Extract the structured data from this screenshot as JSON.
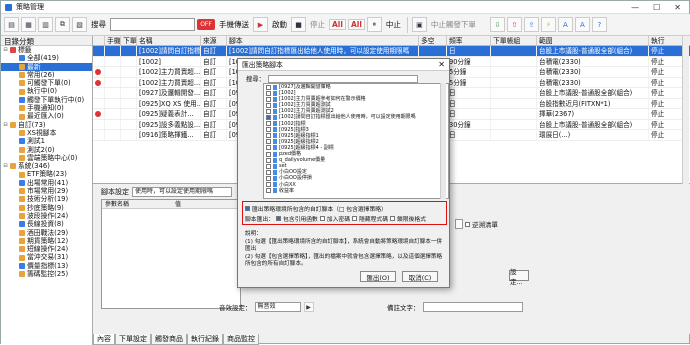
{
  "window": {
    "title": "策略管理"
  },
  "toolbar": {
    "search_label": "搜尋",
    "off_label": "OFF",
    "batch_label": "手機傳送",
    "start_label": "啟動",
    "stop_label": "停止",
    "all_on_label": "All",
    "all_off_label": "All",
    "pause_label": "中止",
    "order_label": "中止觸發下單"
  },
  "tree": {
    "header": "目錄分類",
    "nodes": [
      {
        "label": "標籤",
        "icon": "tag-icon",
        "level": 0
      },
      {
        "label": "全部(419)",
        "icon": "folder-icon",
        "level": 1
      },
      {
        "label": "最新",
        "icon": "folder-icon",
        "level": 1,
        "selected": true
      },
      {
        "label": "常用(26)",
        "icon": "folder-icon",
        "level": 1
      },
      {
        "label": "可觸發下單(0)",
        "icon": "folder-icon",
        "level": 1
      },
      {
        "label": "執行中(0)",
        "icon": "folder-icon",
        "level": 1
      },
      {
        "label": "觸發下單執行中(0)",
        "icon": "folder-icon",
        "level": 1
      },
      {
        "label": "手機通知(0)",
        "icon": "folder-icon",
        "level": 1
      },
      {
        "label": "最近匯入(0)",
        "icon": "folder-icon",
        "level": 1
      },
      {
        "label": "自訂(73)",
        "icon": "folder-icon",
        "level": 0
      },
      {
        "label": "XS視腳本",
        "icon": "folder-icon",
        "level": 1
      },
      {
        "label": "測試1",
        "icon": "folder-icon",
        "level": 1
      },
      {
        "label": "測試2(0)",
        "icon": "folder-icon",
        "level": 1
      },
      {
        "label": "雲端策略中心(0)",
        "icon": "folder-icon",
        "level": 1
      },
      {
        "label": "系統(346)",
        "icon": "folder-icon",
        "level": 0
      },
      {
        "label": "ETF策略(23)",
        "icon": "folder-icon",
        "level": 1
      },
      {
        "label": "出場常用(41)",
        "icon": "folder-icon",
        "level": 1
      },
      {
        "label": "市場常用(29)",
        "icon": "folder-icon",
        "level": 1
      },
      {
        "label": "技術分析(19)",
        "icon": "folder-icon",
        "level": 1
      },
      {
        "label": "抄底策略(9)",
        "icon": "folder-icon",
        "level": 1
      },
      {
        "label": "波段操作(24)",
        "icon": "folder-icon",
        "level": 1
      },
      {
        "label": "長線投資(8)",
        "icon": "folder-icon",
        "level": 1
      },
      {
        "label": "酒田戰法(29)",
        "icon": "folder-icon",
        "level": 1
      },
      {
        "label": "期貨策略(12)",
        "icon": "folder-icon",
        "level": 1
      },
      {
        "label": "短線操作(24)",
        "icon": "folder-icon",
        "level": 1
      },
      {
        "label": "當沖交易(31)",
        "icon": "folder-icon",
        "level": 1
      },
      {
        "label": "價量指標(13)",
        "icon": "folder-icon",
        "level": 1
      },
      {
        "label": "籌碼監控(25)",
        "icon": "folder-icon",
        "level": 1
      }
    ]
  },
  "grid": {
    "columns": [
      "",
      "手機",
      "下單",
      "名稱",
      "來源",
      "腳本",
      "多空",
      "頻率",
      "下單帳組",
      "範圍",
      "執行"
    ],
    "rows": [
      {
        "icon": false,
        "name": "[1002]請問自訂指標",
        "source": "自訂",
        "script": "[1002]請問自訂指標匯出給他人使用時，可以設定使用期限嗎",
        "side": "",
        "freq": "日",
        "range": "台股上市議股-普通股全部(組合)",
        "status": "停止",
        "hl": true
      },
      {
        "icon": false,
        "name": "[1002]",
        "source": "自訂",
        "script": "[1002]",
        "side": "",
        "freq": "90分鐘",
        "range": "台積電(2330)",
        "status": "停止"
      },
      {
        "icon": true,
        "name": "[1002]主力買賣超...",
        "source": "自訂",
        "script": "[1002]主力買賣超...",
        "side": "",
        "freq": "5分鐘",
        "range": "台積電(2330)",
        "status": "停止"
      },
      {
        "icon": true,
        "name": "[1002]主力買賣超...",
        "source": "自訂",
        "script": "[1002]主力買賣超...",
        "side": "",
        "freq": "5分鐘",
        "range": "台積電(2330)",
        "status": "停止"
      },
      {
        "icon": false,
        "name": "[0927]及邏輯開發...",
        "source": "自訂",
        "script": "[0927]及邏輯開發...",
        "side": "",
        "freq": "日",
        "range": "台股上市議股-普通股全部(組合)",
        "status": "停止"
      },
      {
        "icon": false,
        "name": "[0925]XQ XS 使用...",
        "source": "自訂",
        "script": "[0925]XQ XS 使用...",
        "side": "",
        "freq": "日",
        "range": "台股指數近月(FITXN*1)",
        "status": "停止"
      },
      {
        "icon": true,
        "name": "[0925]疑義表計...",
        "source": "自訂",
        "script": "[0925]疑義表計...",
        "side": "",
        "freq": "日",
        "range": "擇華(2367)",
        "status": "停止"
      },
      {
        "icon": false,
        "name": "[0925]設多義點設...",
        "source": "自訂",
        "script": "[0925]設多義點設...",
        "side": "",
        "freq": "30分鐘",
        "range": "台股上市議股-普通股全部(組合)",
        "status": "停止"
      },
      {
        "icon": false,
        "name": "[0916]策略揮鐵...",
        "source": "自訂",
        "script": "[0916]策略揮鐵...",
        "side": "",
        "freq": "日",
        "range": "環展日(...)",
        "status": "停止"
      }
    ]
  },
  "lower": {
    "script_label": "腳本設定",
    "script_value": "使用時，可以設定使用期限嗎",
    "params_label": "參數名稱",
    "value_label": "值",
    "fix_label": "逆溯清單",
    "settings_btn": "設定...",
    "sound_label": "音效設定：",
    "sound_value": "無音效",
    "extra_label": "備註文字："
  },
  "bottom_tabs": [
    "內容",
    "下單設定",
    "觸發商品",
    "執行紀錄",
    "商品監控"
  ],
  "modal": {
    "title": "匯出策略腳本",
    "search_label": "搜尋：",
    "items": [
      "[0927]及邏輯開發策略",
      "[1002]",
      "[1002]主力買賣超參考如何在警示價格",
      "[1002]主力買賣超測試",
      "[1002]主力買賣超測試2",
      "[1002]請問自訂指標匯出給他人使用時，可以設定使用期限嗎",
      "[1002]指標",
      "[0925]指標3",
      "[0925]超級指標1",
      "[0925]超級指標2",
      "[0925]超級指標4 - 副標",
      "pzed價格",
      "q_dailyvolume價量",
      "set",
      "小白OO設定",
      "小白OO設停損",
      "小白XX",
      "收益率"
    ],
    "checked_index": 5,
    "opt1": "匯出策略環境所包含的自訂腳本（□ 包含選擇策略）",
    "opt2_label": "腳本匯出：",
    "opt2_a": "包含引用函數",
    "opt2_b": "加入密碼",
    "opt2_c": "隱藏程式碼",
    "opt2_d": "鎖限後格式",
    "desc_title": "說明：",
    "desc1": "(1) 勾選【匯出策略環境所含的自訂腳本】，系統會自動將策略環境自訂腳本一併匯出",
    "desc2": "(2) 勾選【包含選擇策略】，匯出的檔案中就會包含選擇策略，以及這個選擇策略所包含的所有自訂腳本。",
    "ok_label": "匯出(O)",
    "cancel_label": "取消(C)"
  }
}
